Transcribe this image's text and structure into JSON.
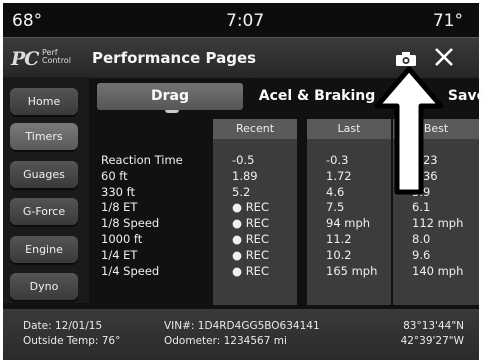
{
  "status": {
    "temp_left": "68°",
    "time": "7:07",
    "temp_right": "71°"
  },
  "header": {
    "logo_pc": "PC",
    "logo_perf": "Perf",
    "logo_control": "Control",
    "title": "Performance Pages"
  },
  "sidebar": {
    "items": [
      {
        "label": "Home"
      },
      {
        "label": "Timers"
      },
      {
        "label": "Guages"
      },
      {
        "label": "G-Force"
      },
      {
        "label": "Engine"
      },
      {
        "label": "Dyno"
      }
    ]
  },
  "tabs": {
    "drag": "Drag",
    "braking": "Acel & Braking",
    "save": "Save"
  },
  "table": {
    "headers": {
      "recent": "Recent",
      "last": "Last",
      "best": "Best"
    },
    "rows": [
      {
        "label": "Reaction Time",
        "recent": "-0.5",
        "last": "-0.3",
        "best": "0.23"
      },
      {
        "label": "60 ft",
        "recent": "1.89",
        "last": "1.72",
        "best": "1.36"
      },
      {
        "label": "330 ft",
        "recent": "5.2",
        "last": "4.6",
        "best": "3.9"
      },
      {
        "label": "1/8 ET",
        "recent": "● REC",
        "last": "7.5",
        "best": "6.1"
      },
      {
        "label": "1/8 Speed",
        "recent": "● REC",
        "last": "94 mph",
        "best": "112 mph"
      },
      {
        "label": "1000 ft",
        "recent": "● REC",
        "last": "11.2",
        "best": "8.0"
      },
      {
        "label": "1/4 ET",
        "recent": "● REC",
        "last": "10.2",
        "best": "9.6"
      },
      {
        "label": "1/4 Speed",
        "recent": "● REC",
        "last": "165 mph",
        "best": "140 mph"
      }
    ]
  },
  "footer": {
    "date": "Date: 12/01/15",
    "outside_temp": "Outside Temp: 76°",
    "vin": "VIN#: 1D4RD4GG5BO634141",
    "odometer": "Odometer: 1234567 mi",
    "longitude": "83°13'44\"N",
    "latitude": "42°39'27\"W"
  },
  "icons": {
    "camera": "camera-icon",
    "close": "close-icon",
    "arrow": "up-arrow-callout"
  }
}
